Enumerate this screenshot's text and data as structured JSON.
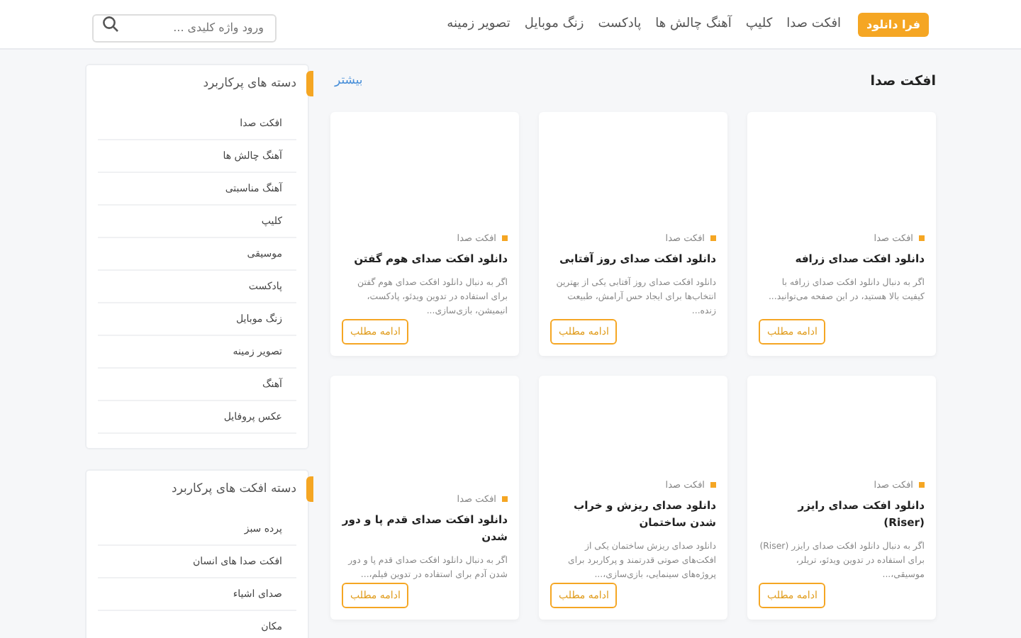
{
  "header": {
    "logo": "فرا دانلود",
    "nav": [
      {
        "label": "افکت صدا"
      },
      {
        "label": "کلیپ"
      },
      {
        "label": "آهنگ چالش ها"
      },
      {
        "label": "پادکست"
      },
      {
        "label": "زنگ موبایل"
      },
      {
        "label": "تصویر زمینه"
      }
    ],
    "search": {
      "placeholder": "ورود واژه کلیدی ..."
    }
  },
  "section": {
    "title": "افکت صدا",
    "more": "بیشتر"
  },
  "posts": [
    {
      "category": "افکت صدا",
      "title": "دانلود افکت صدای زرافه",
      "excerpt": "اگر به دنبال دانلود افکت صدای زرافه با کیفیت بالا هستید، در این صفحه می‌توانید...",
      "button": "ادامه مطلب"
    },
    {
      "category": "افکت صدا",
      "title": "دانلود افکت صدای روز آفتابی",
      "excerpt": "دانلود افکت صدای روز آفتابی یکی از بهترین انتخاب‌ها برای ایجاد حس آرامش، طبیعت زنده...",
      "button": "ادامه مطلب"
    },
    {
      "category": "افکت صدا",
      "title": "دانلود افکت صدای هوم گفتن",
      "excerpt": "اگر به دنبال دانلود افکت صدای هوم گفتن برای استفاده در تدوین ویدئو، پادکست، انیمیشن، بازی‌سازی...",
      "button": "ادامه مطلب"
    },
    {
      "category": "افکت صدا",
      "title": "دانلود افکت صدای رایزر (Riser)",
      "excerpt": "اگر به دنبال دانلود افکت صدای رایزر (Riser) برای استفاده در تدوین ویدئو، تریلر، موسیقی،...",
      "button": "ادامه مطلب"
    },
    {
      "category": "افکت صدا",
      "title": "دانلود صدای ریزش و خراب شدن ساختمان",
      "excerpt": "دانلود صدای ریزش ساختمان یکی از افکت‌های صوتی قدرتمند و پرکاربرد برای پروژه‌های سینمایی، بازی‌سازی،...",
      "button": "ادامه مطلب"
    },
    {
      "category": "افکت صدا",
      "title": "دانلود افکت صدای قدم پا و دور شدن",
      "excerpt": "اگر به دنبال دانلود افکت صدای قدم پا و دور شدن آدم برای استفاده در تدوین فیلم،...",
      "button": "ادامه مطلب"
    }
  ],
  "sidebar": [
    {
      "title": "دسته های پرکاربرد",
      "items": [
        "افکت صدا",
        "آهنگ چالش ها",
        "آهنگ مناسبتی",
        "کلیپ",
        "موسیقی",
        "پادکست",
        "زنگ موبایل",
        "تصویر زمینه",
        "آهنگ",
        "عکس پروفایل"
      ]
    },
    {
      "title": "دسته افکت های پرکاربرد",
      "items": [
        "پرده سبز",
        "افکت صدا های انسان",
        "صدای اشیاء",
        "مکان"
      ]
    }
  ]
}
